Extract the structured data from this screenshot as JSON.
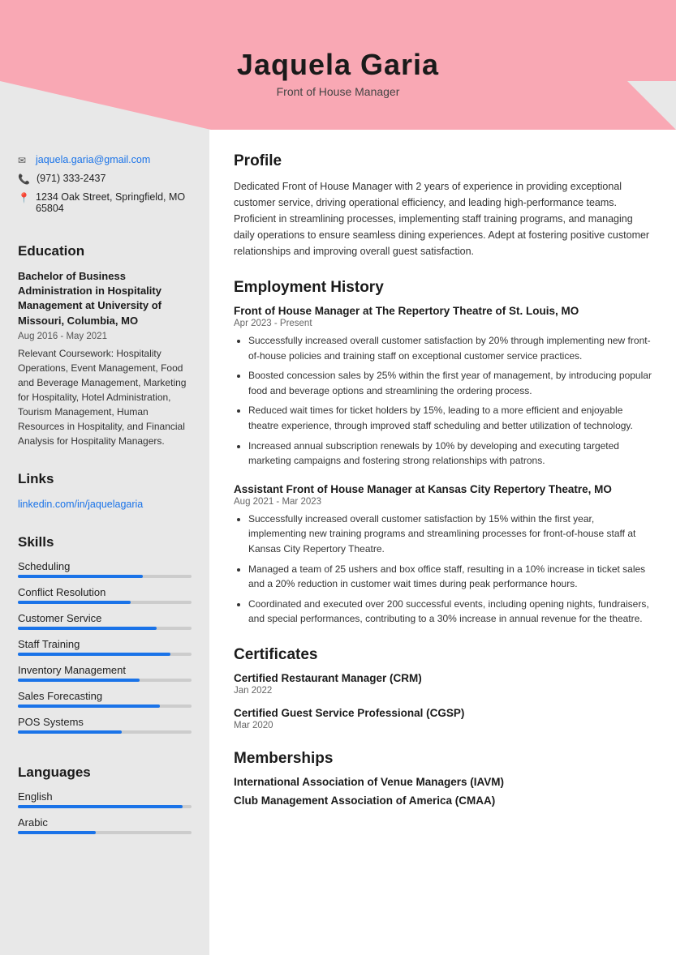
{
  "header": {
    "name": "Jaquela Garia",
    "title": "Front of House Manager"
  },
  "sidebar": {
    "contact": {
      "email": "jaquela.garia@gmail.com",
      "phone": "(971) 333-2437",
      "address": "1234 Oak Street, Springfield, MO 65804"
    },
    "education": {
      "degree": "Bachelor of Business Administration in Hospitality Management at University of Missouri, Columbia, MO",
      "dates": "Aug 2016 - May 2021",
      "coursework": "Relevant Coursework: Hospitality Operations, Event Management, Food and Beverage Management, Marketing for Hospitality, Hotel Administration, Tourism Management, Human Resources in Hospitality, and Financial Analysis for Hospitality Managers."
    },
    "links": {
      "linkedin": "linkedin.com/in/jaquelagaria"
    },
    "skills": [
      {
        "name": "Scheduling",
        "pct": 72
      },
      {
        "name": "Conflict Resolution",
        "pct": 65
      },
      {
        "name": "Customer Service",
        "pct": 80
      },
      {
        "name": "Staff Training",
        "pct": 88
      },
      {
        "name": "Inventory Management",
        "pct": 70
      },
      {
        "name": "Sales Forecasting",
        "pct": 82
      },
      {
        "name": "POS Systems",
        "pct": 60
      }
    ],
    "languages": [
      {
        "name": "English",
        "pct": 95
      },
      {
        "name": "Arabic",
        "pct": 45
      }
    ]
  },
  "main": {
    "sections": {
      "profile_title": "Profile",
      "profile_text": "Dedicated Front of House Manager with 2 years of experience in providing exceptional customer service, driving operational efficiency, and leading high-performance teams. Proficient in streamlining processes, implementing staff training programs, and managing daily operations to ensure seamless dining experiences. Adept at fostering positive customer relationships and improving overall guest satisfaction.",
      "employment_title": "Employment History",
      "jobs": [
        {
          "title": "Front of House Manager at The Repertory Theatre of St. Louis, MO",
          "dates": "Apr 2023 - Present",
          "bullets": [
            "Successfully increased overall customer satisfaction by 20% through implementing new front-of-house policies and training staff on exceptional customer service practices.",
            "Boosted concession sales by 25% within the first year of management, by introducing popular food and beverage options and streamlining the ordering process.",
            "Reduced wait times for ticket holders by 15%, leading to a more efficient and enjoyable theatre experience, through improved staff scheduling and better utilization of technology.",
            "Increased annual subscription renewals by 10% by developing and executing targeted marketing campaigns and fostering strong relationships with patrons."
          ]
        },
        {
          "title": "Assistant Front of House Manager at Kansas City Repertory Theatre, MO",
          "dates": "Aug 2021 - Mar 2023",
          "bullets": [
            "Successfully increased overall customer satisfaction by 15% within the first year, implementing new training programs and streamlining processes for front-of-house staff at Kansas City Repertory Theatre.",
            "Managed a team of 25 ushers and box office staff, resulting in a 10% increase in ticket sales and a 20% reduction in customer wait times during peak performance hours.",
            "Coordinated and executed over 200 successful events, including opening nights, fundraisers, and special performances, contributing to a 30% increase in annual revenue for the theatre."
          ]
        }
      ],
      "certificates_title": "Certificates",
      "certificates": [
        {
          "name": "Certified Restaurant Manager (CRM)",
          "date": "Jan 2022"
        },
        {
          "name": "Certified Guest Service Professional (CGSP)",
          "date": "Mar 2020"
        }
      ],
      "memberships_title": "Memberships",
      "memberships": [
        "International Association of Venue Managers (IAVM)",
        "Club Management Association of America (CMAA)"
      ]
    }
  }
}
